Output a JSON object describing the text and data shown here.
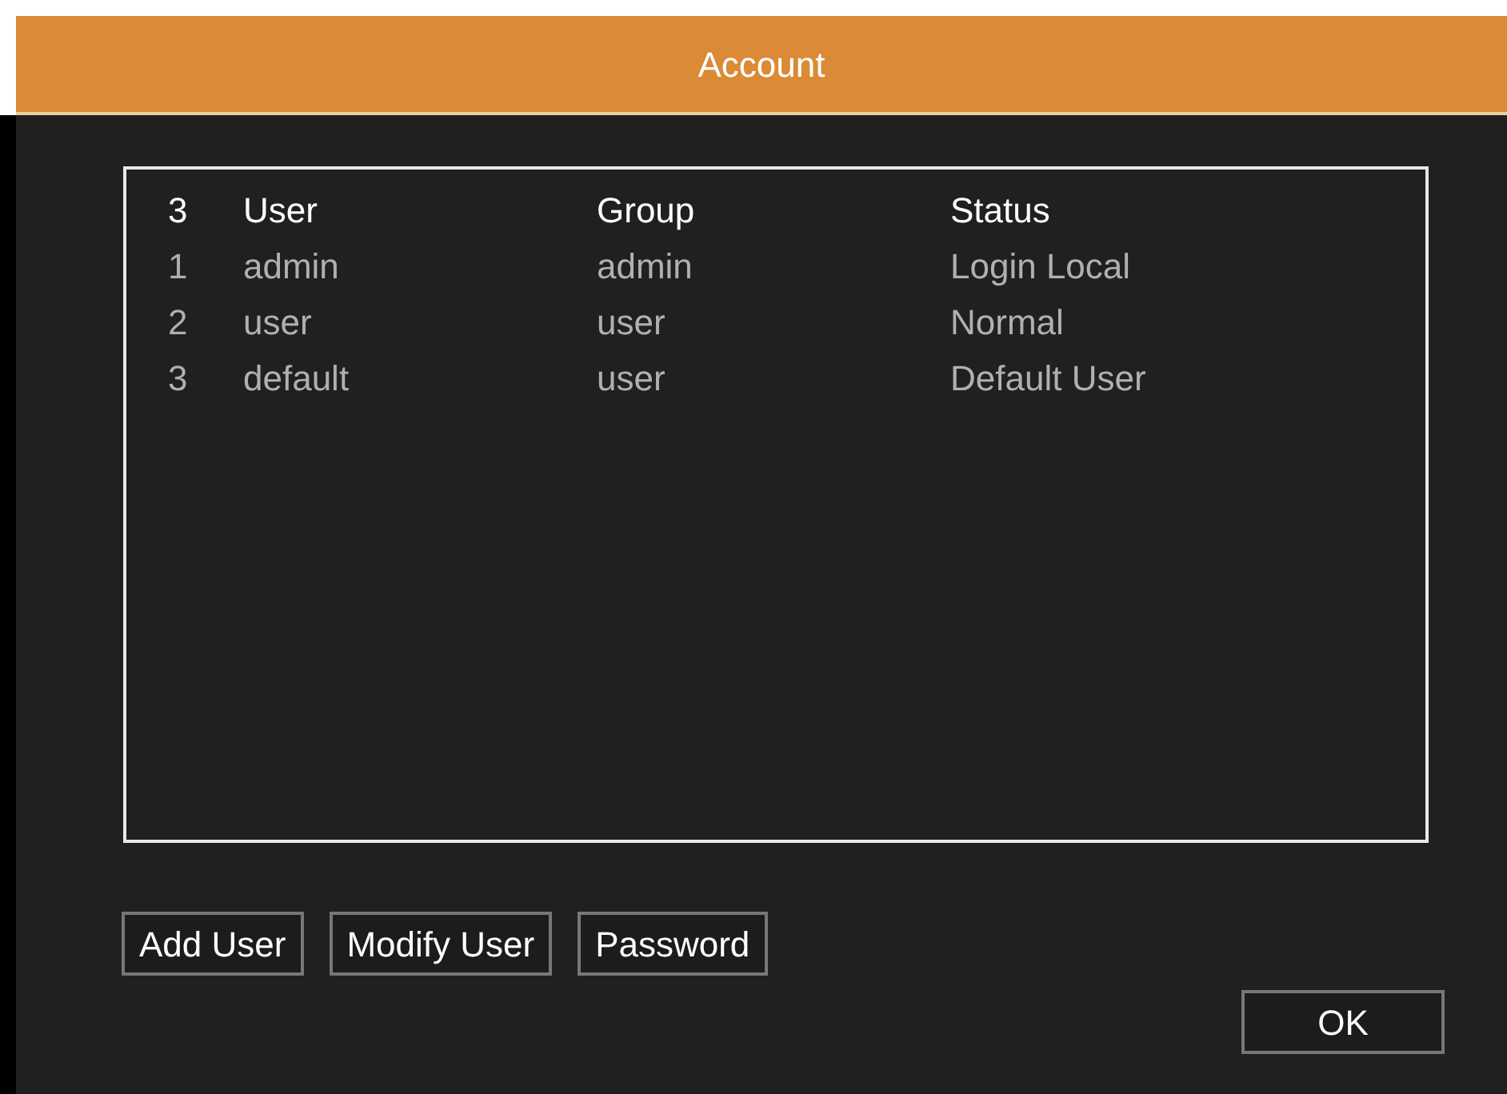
{
  "window": {
    "title": "Account"
  },
  "table": {
    "count": "3",
    "columns": [
      "User",
      "Group",
      "Status"
    ],
    "rows": [
      {
        "index": "1",
        "user": "admin",
        "group": "admin",
        "status": "Login Local"
      },
      {
        "index": "2",
        "user": "user",
        "group": "user",
        "status": "Normal"
      },
      {
        "index": "3",
        "user": "default",
        "group": "user",
        "status": "Default User"
      }
    ]
  },
  "buttons": [
    "Add User",
    "Modify User",
    "Password"
  ],
  "ok_button": "OK"
}
